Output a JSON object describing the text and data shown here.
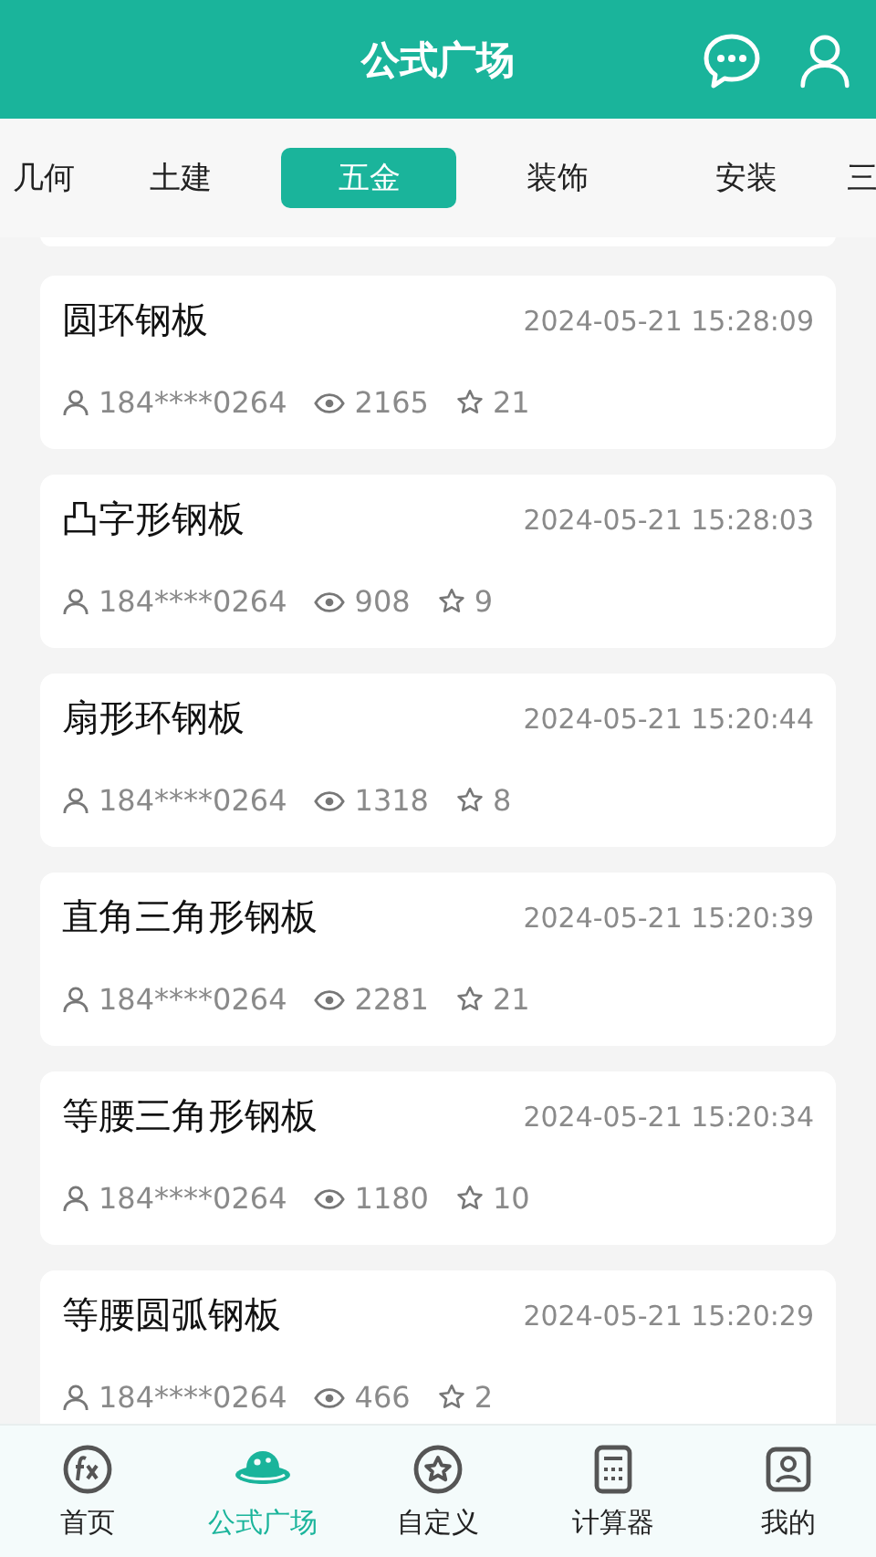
{
  "header": {
    "title": "公式广场"
  },
  "tabs": [
    {
      "label": "几何",
      "selected": false
    },
    {
      "label": "土建",
      "selected": false
    },
    {
      "label": "五金",
      "selected": true
    },
    {
      "label": "装饰",
      "selected": false
    },
    {
      "label": "安装",
      "selected": false
    },
    {
      "label": "三",
      "selected": false
    }
  ],
  "formulas": [
    {
      "name": "圆环钢板",
      "time": "2024-05-21 15:28:09",
      "author": "184****0264",
      "views": "2165",
      "stars": "21"
    },
    {
      "name": "凸字形钢板",
      "time": "2024-05-21 15:28:03",
      "author": "184****0264",
      "views": "908",
      "stars": "9"
    },
    {
      "name": "扇形环钢板",
      "time": "2024-05-21 15:20:44",
      "author": "184****0264",
      "views": "1318",
      "stars": "8"
    },
    {
      "name": "直角三角形钢板",
      "time": "2024-05-21 15:20:39",
      "author": "184****0264",
      "views": "2281",
      "stars": "21"
    },
    {
      "name": "等腰三角形钢板",
      "time": "2024-05-21 15:20:34",
      "author": "184****0264",
      "views": "1180",
      "stars": "10"
    },
    {
      "name": "等腰圆弧钢板",
      "time": "2024-05-21 15:20:29",
      "author": "184****0264",
      "views": "466",
      "stars": "2"
    }
  ],
  "nav": [
    {
      "kind": "fx",
      "label": "首页",
      "selected": false
    },
    {
      "kind": "planet",
      "label": "公式广场",
      "selected": true
    },
    {
      "kind": "star",
      "label": "自定义",
      "selected": false
    },
    {
      "kind": "calc",
      "label": "计算器",
      "selected": false
    },
    {
      "kind": "user",
      "label": "我的",
      "selected": false
    }
  ]
}
